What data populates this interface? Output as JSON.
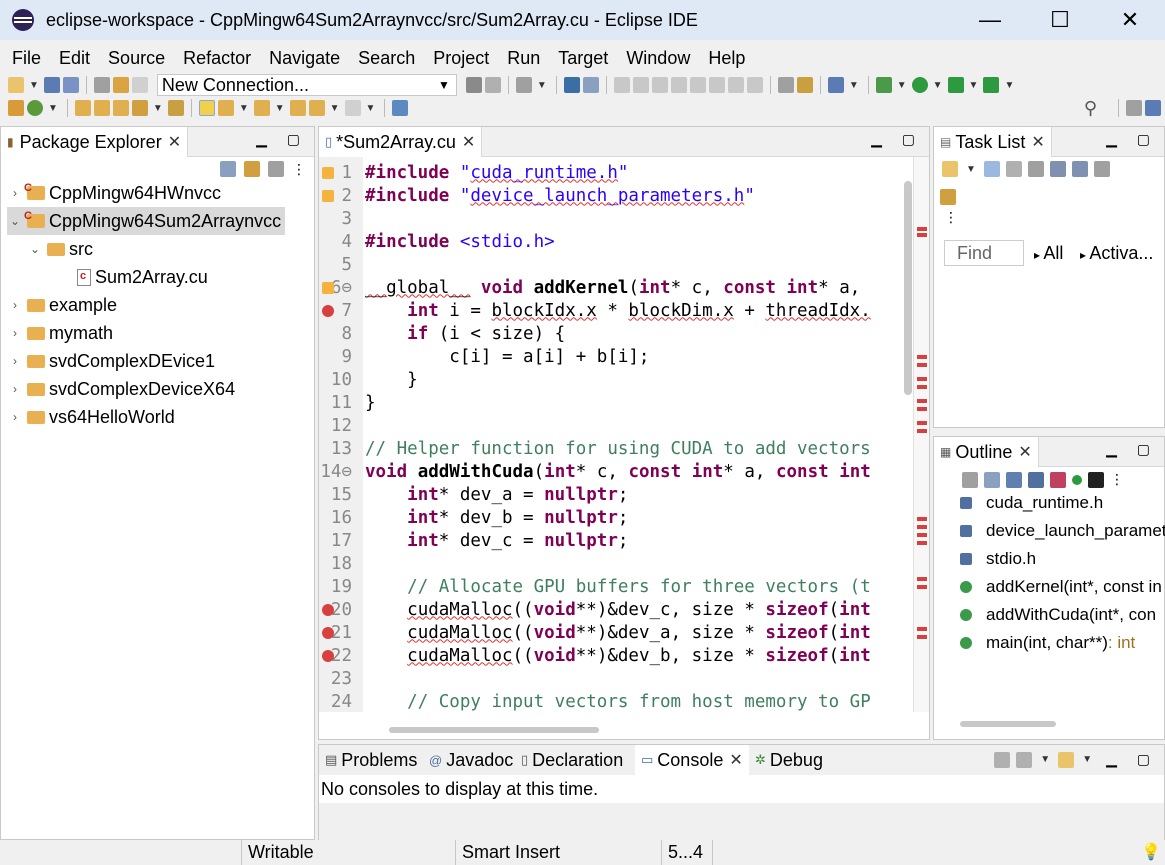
{
  "window": {
    "title": "eclipse-workspace - CppMingw64Sum2Arraynvcc/src/Sum2Array.cu - Eclipse IDE",
    "minimize": "—",
    "maximize": "☐",
    "close": "✕"
  },
  "menu": [
    "File",
    "Edit",
    "Source",
    "Refactor",
    "Navigate",
    "Search",
    "Project",
    "Run",
    "Target",
    "Window",
    "Help"
  ],
  "toolbar": {
    "connection": "New Connection..."
  },
  "package_explorer": {
    "tab_label": "Package Explorer",
    "items": [
      {
        "label": "CppMingw64HWnvcc",
        "kind": "project",
        "expanded": false
      },
      {
        "label": "CppMingw64Sum2Arraynvcc",
        "kind": "project",
        "expanded": true
      },
      {
        "label": "src",
        "kind": "folder",
        "expanded": true
      },
      {
        "label": "Sum2Array.cu",
        "kind": "file"
      },
      {
        "label": "example",
        "kind": "project",
        "expanded": false
      },
      {
        "label": "mymath",
        "kind": "project",
        "expanded": false
      },
      {
        "label": "svdComplexDEvice1",
        "kind": "project",
        "expanded": false
      },
      {
        "label": "svdComplexDeviceX64",
        "kind": "project",
        "expanded": false
      },
      {
        "label": "vs64HelloWorld",
        "kind": "project",
        "expanded": false
      }
    ]
  },
  "editor": {
    "tab_label": "*Sum2Array.cu",
    "lines": [
      {
        "n": "1",
        "text": "#include \"cuda_runtime.h\""
      },
      {
        "n": "2",
        "text": "#include \"device_launch_parameters.h\""
      },
      {
        "n": "3",
        "text": ""
      },
      {
        "n": "4",
        "text": "#include <stdio.h>"
      },
      {
        "n": "5",
        "text": ""
      },
      {
        "n": "6⊖",
        "text": "__global__ void addKernel(int* c, const int* a,"
      },
      {
        "n": "7",
        "text": "    int i = blockIdx.x * blockDim.x + threadIdx."
      },
      {
        "n": "8",
        "text": "    if (i < size) {"
      },
      {
        "n": "9",
        "text": "        c[i] = a[i] + b[i];"
      },
      {
        "n": "10",
        "text": "    }"
      },
      {
        "n": "11",
        "text": "}"
      },
      {
        "n": "12",
        "text": ""
      },
      {
        "n": "13",
        "text": "// Helper function for using CUDA to add vectors"
      },
      {
        "n": "14⊖",
        "text": "void addWithCuda(int* c, const int* a, const int"
      },
      {
        "n": "15",
        "text": "    int* dev_a = nullptr;"
      },
      {
        "n": "16",
        "text": "    int* dev_b = nullptr;"
      },
      {
        "n": "17",
        "text": "    int* dev_c = nullptr;"
      },
      {
        "n": "18",
        "text": ""
      },
      {
        "n": "19",
        "text": "    // Allocate GPU buffers for three vectors (t"
      },
      {
        "n": "20",
        "text": "    cudaMalloc((void**)&dev_c, size * sizeof(int"
      },
      {
        "n": "21",
        "text": "    cudaMalloc((void**)&dev_a, size * sizeof(int"
      },
      {
        "n": "22",
        "text": "    cudaMalloc((void**)&dev_b, size * sizeof(int"
      },
      {
        "n": "23",
        "text": ""
      },
      {
        "n": "24",
        "text": "    // Copy input vectors from host memory to GP"
      }
    ]
  },
  "task_list": {
    "tab_label": "Task List",
    "find_placeholder": "Find",
    "filter_all": "All",
    "filter_activate": "Activa..."
  },
  "outline": {
    "tab_label": "Outline",
    "items": [
      {
        "label": "cuda_runtime.h",
        "type": ""
      },
      {
        "label": "device_launch_paramet",
        "type": ""
      },
      {
        "label": "stdio.h",
        "type": ""
      },
      {
        "label": "addKernel(int*, const in",
        "type": ""
      },
      {
        "label": "addWithCuda(int*, con",
        "type": ""
      },
      {
        "label": "main(int, char**)",
        "type": " : int"
      }
    ]
  },
  "bottom_panel": {
    "tabs": [
      "Problems",
      "Javadoc",
      "Declaration",
      "Console",
      "Debug"
    ],
    "active_tab": "Console",
    "message": "No consoles to display at this time."
  },
  "status": {
    "writable": "Writable",
    "insert_mode": "Smart Insert",
    "position": "5...4"
  },
  "colors": {
    "keyword": "#7f0055",
    "string": "#2a00ff",
    "comment": "#3f7f5f",
    "titlebar": "#dfe8f5"
  }
}
